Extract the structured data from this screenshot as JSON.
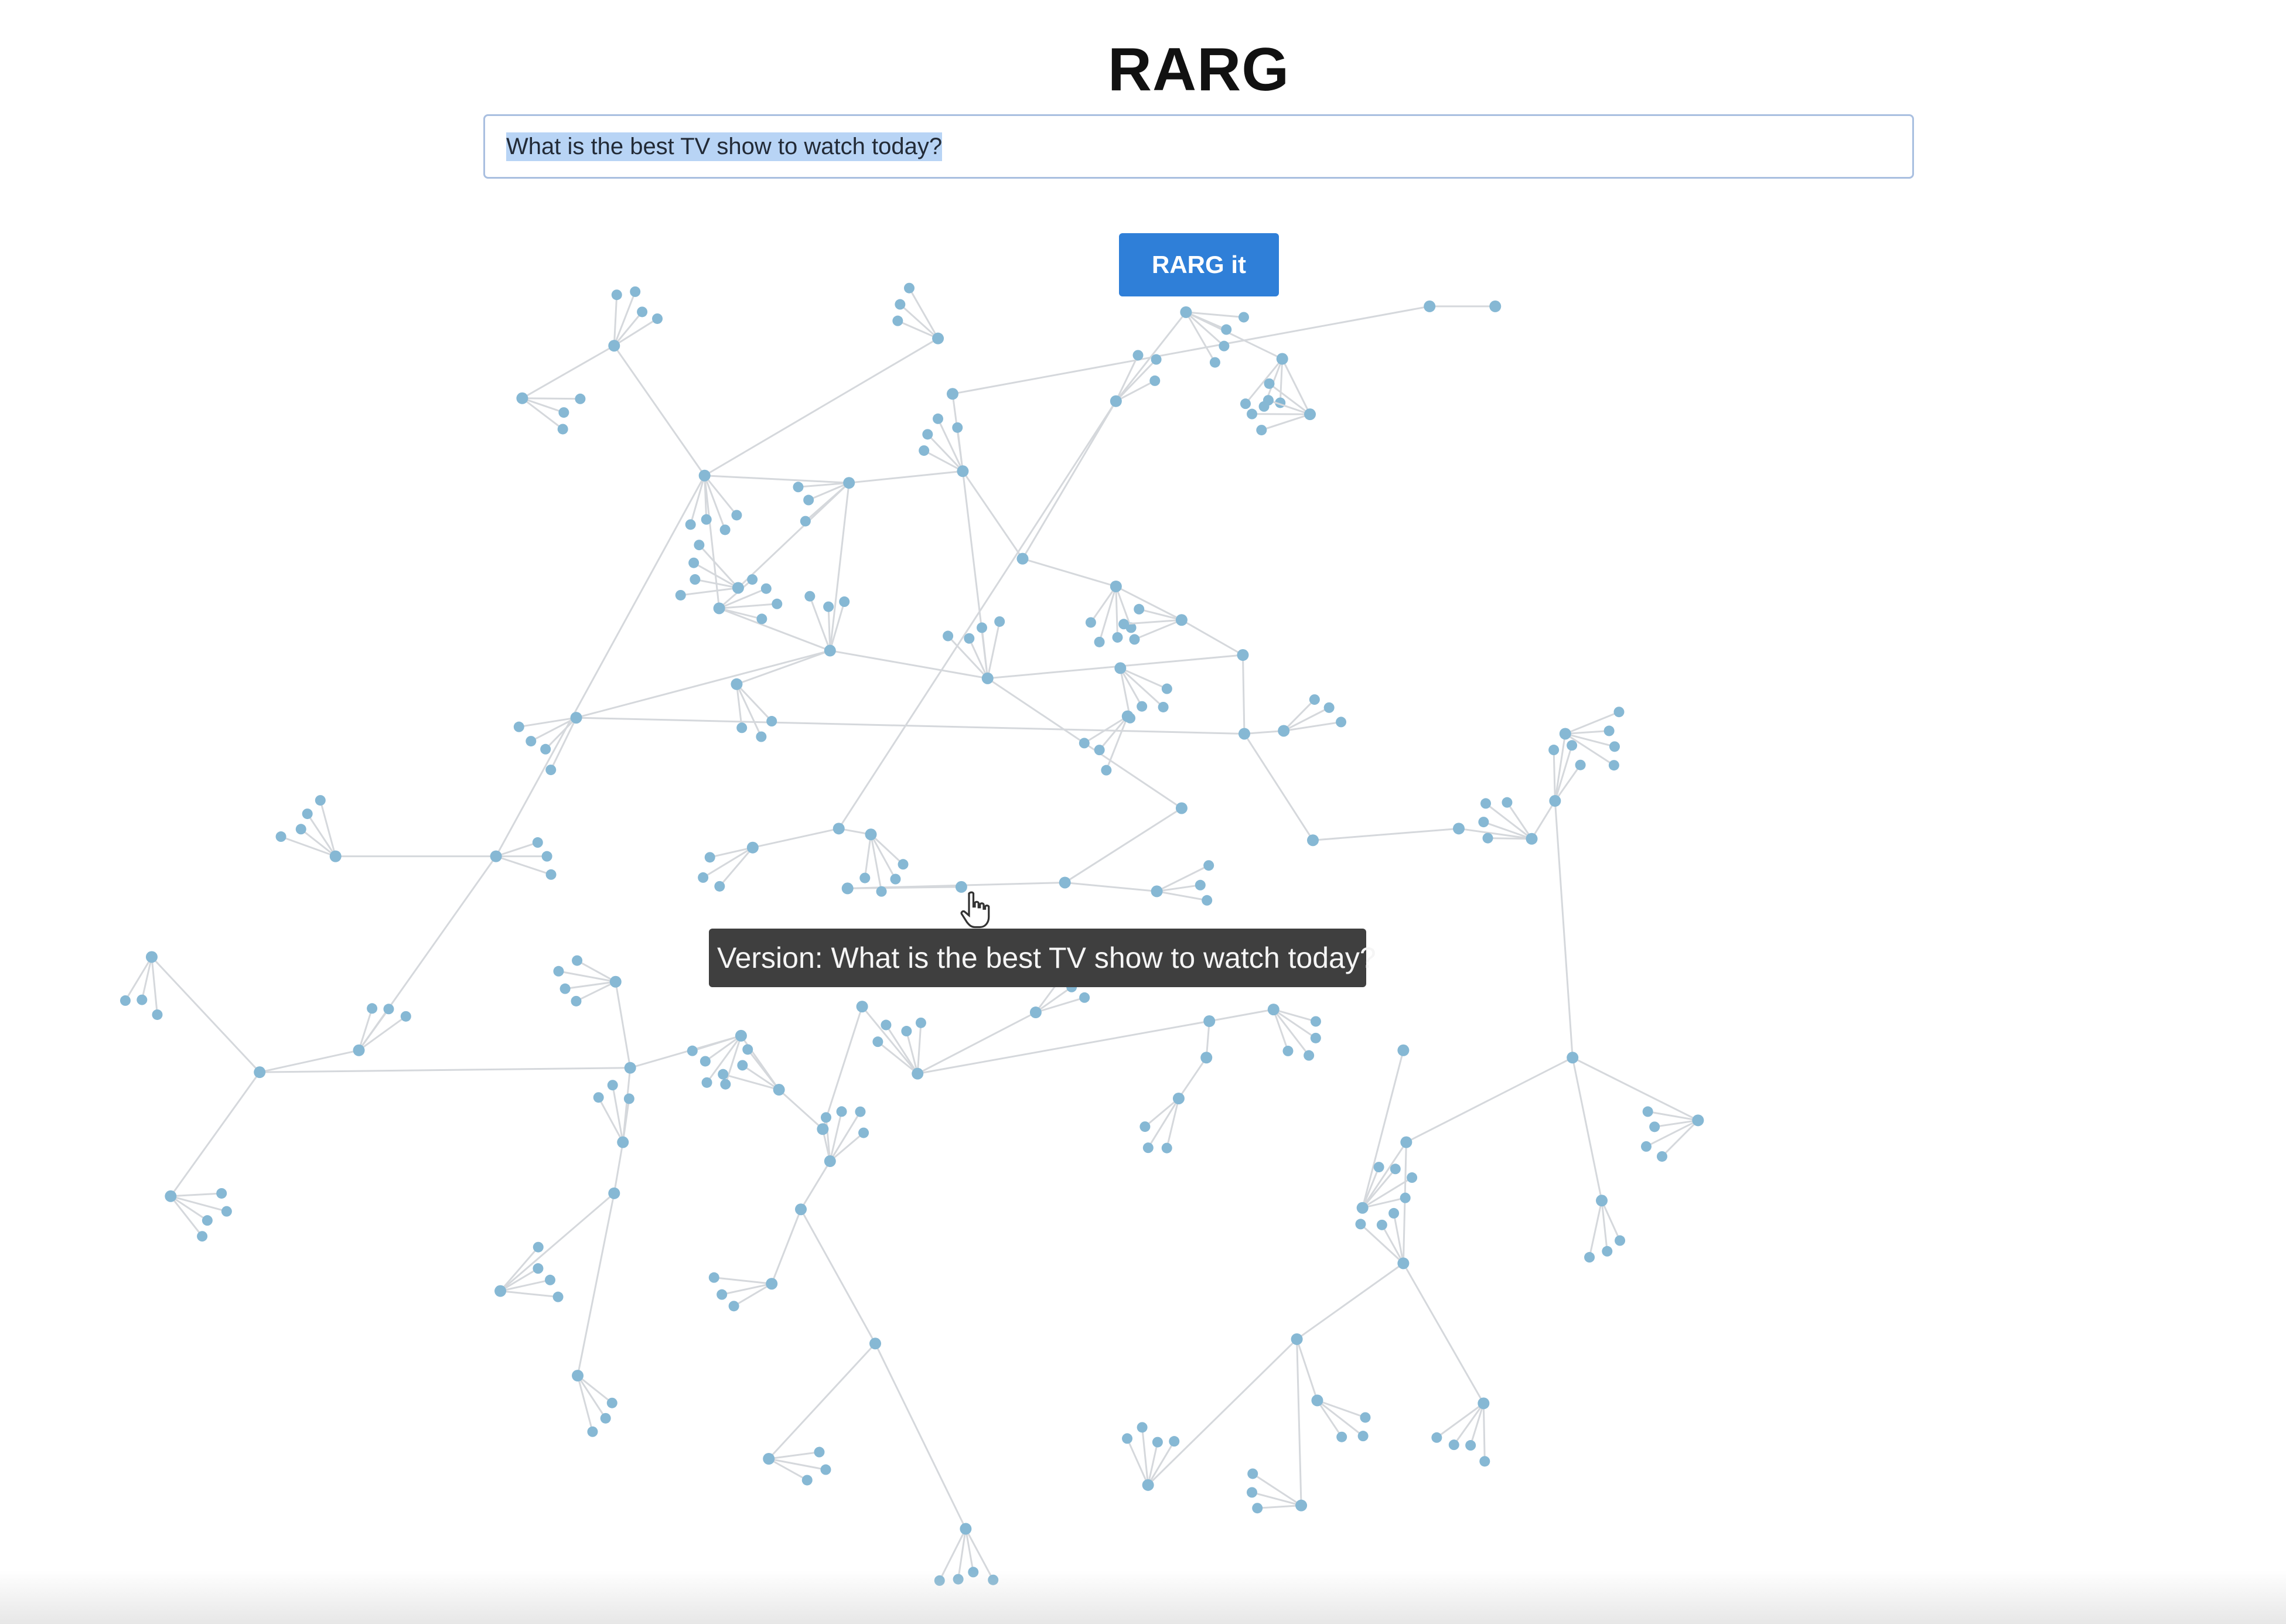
{
  "app": {
    "title": "RARG"
  },
  "search": {
    "value": "What is the best TV show to watch today?"
  },
  "actions": {
    "rarg_button_label": "RARG it"
  },
  "tooltip": {
    "text": "Version: What is the best TV show to watch today?"
  },
  "colors": {
    "accent": "#2f7fd8",
    "node": "#86b8d4",
    "edge": "#d5d8dc",
    "tooltip_bg": "#3f3f3f",
    "selection": "#b8d4f5"
  },
  "icons": {
    "cursor": "hand-pointer-icon"
  }
}
